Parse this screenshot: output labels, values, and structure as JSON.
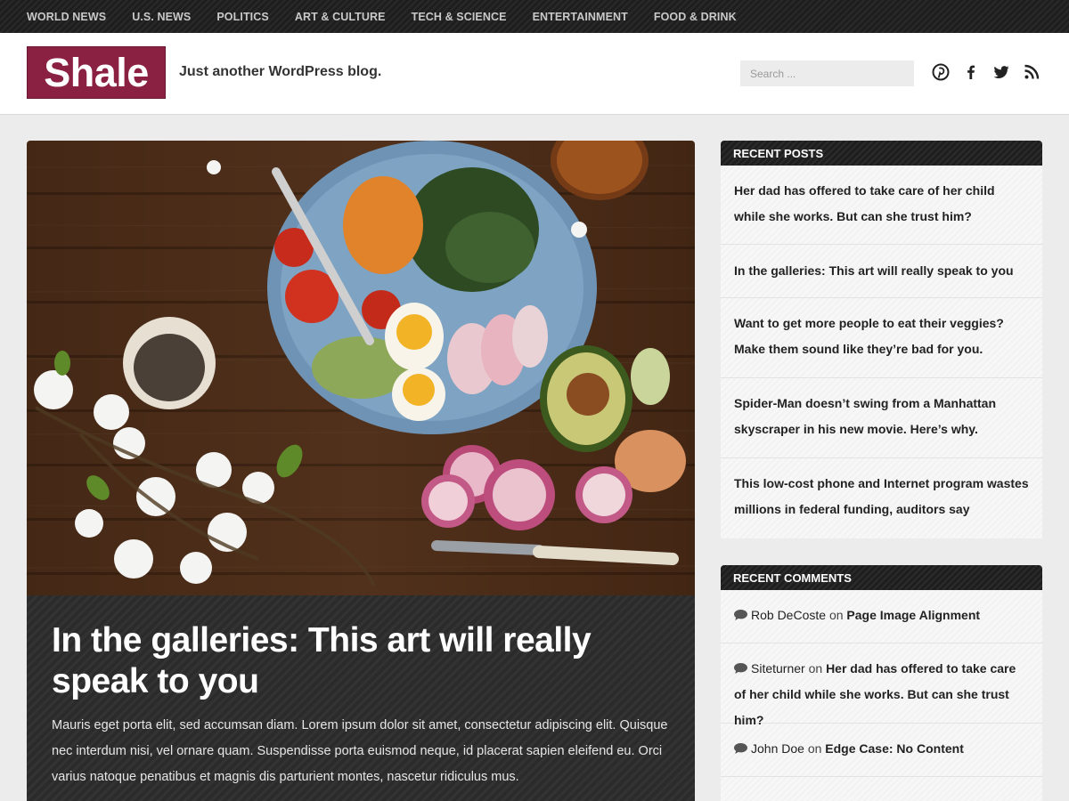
{
  "nav": {
    "items": [
      "WORLD NEWS",
      "U.S. NEWS",
      "POLITICS",
      "ART & CULTURE",
      "TECH & SCIENCE",
      "ENTERTAINMENT",
      "FOOD & DRINK"
    ]
  },
  "header": {
    "logo": "Shale",
    "tagline": "Just another WordPress blog.",
    "search_placeholder": "Search ...",
    "social_icons": [
      "pinterest-icon",
      "facebook-icon",
      "twitter-icon",
      "rss-icon"
    ]
  },
  "feature": {
    "title": "In the galleries: This art will really speak to you",
    "excerpt": "Mauris eget porta elit, sed accumsan diam. Lorem ipsum dolor sit amet, consectetur adipiscing elit. Quisque nec interdum nisi, vel ornare quam. Suspendisse porta euismod neque, id placerat sapien eleifend eu. Orci varius natoque penatibus et magnis dis parturient montes, nascetur ridiculus mus."
  },
  "recent_posts": {
    "title": "RECENT POSTS",
    "items": [
      "Her dad has offered to take care of her child while she works. But can she trust him?",
      "In the galleries: This art will really speak to you",
      "Want to get more people to eat their veggies? Make them sound like they’re bad for you.",
      "Spider-Man doesn’t swing from a Manhattan skyscraper in his new movie. Here’s why.",
      "This low-cost phone and Internet program wastes millions in federal funding, auditors say"
    ]
  },
  "recent_comments": {
    "title": "RECENT COMMENTS",
    "on_word": "on",
    "items": [
      {
        "author": "Rob DeCoste",
        "target": "Page Image Alignment"
      },
      {
        "author": "Siteturner",
        "target": "Her dad has offered to take care of her child while she works. But can she trust him?"
      },
      {
        "author": "John Doe",
        "target": "Edge Case: No Content"
      }
    ]
  },
  "colors": {
    "brand": "#8a2143",
    "nav_bg": "#1e1e1e",
    "page_bg": "#ececec"
  }
}
